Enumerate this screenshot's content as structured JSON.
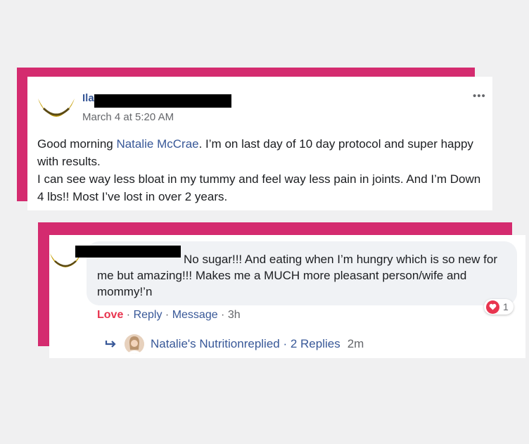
{
  "post": {
    "author_visible": "Ila",
    "timestamp": "March 4 at 5:20 AM",
    "more_label": "•••",
    "text_before_mention": "Good morning ",
    "mention": "Natalie McCrae",
    "text_line1_rest": ". I’m on last day of 10 day protocol and super happy with results.",
    "text_line2": "I can see way less bloat in my tummy and feel way less pain in joints. And I’m Down 4 lbs!! Most I’ve lost in over 2 years."
  },
  "comment": {
    "text": "No sugar!!! And eating when I’m hungry which is so new for me but amazing!!! Makes me a MUCH more pleasant person/wife and mommy!’n",
    "reaction_count": "1",
    "actions": {
      "love": "Love",
      "reply": "Reply",
      "message": "Message",
      "time": "3h",
      "separator": " · "
    },
    "replies": {
      "author": "Natalie's Nutrition",
      "text": " replied · 2 Replies",
      "time": "2m"
    }
  },
  "colors": {
    "accent": "#d42b6f",
    "link": "#385898",
    "love": "#e8354f"
  }
}
